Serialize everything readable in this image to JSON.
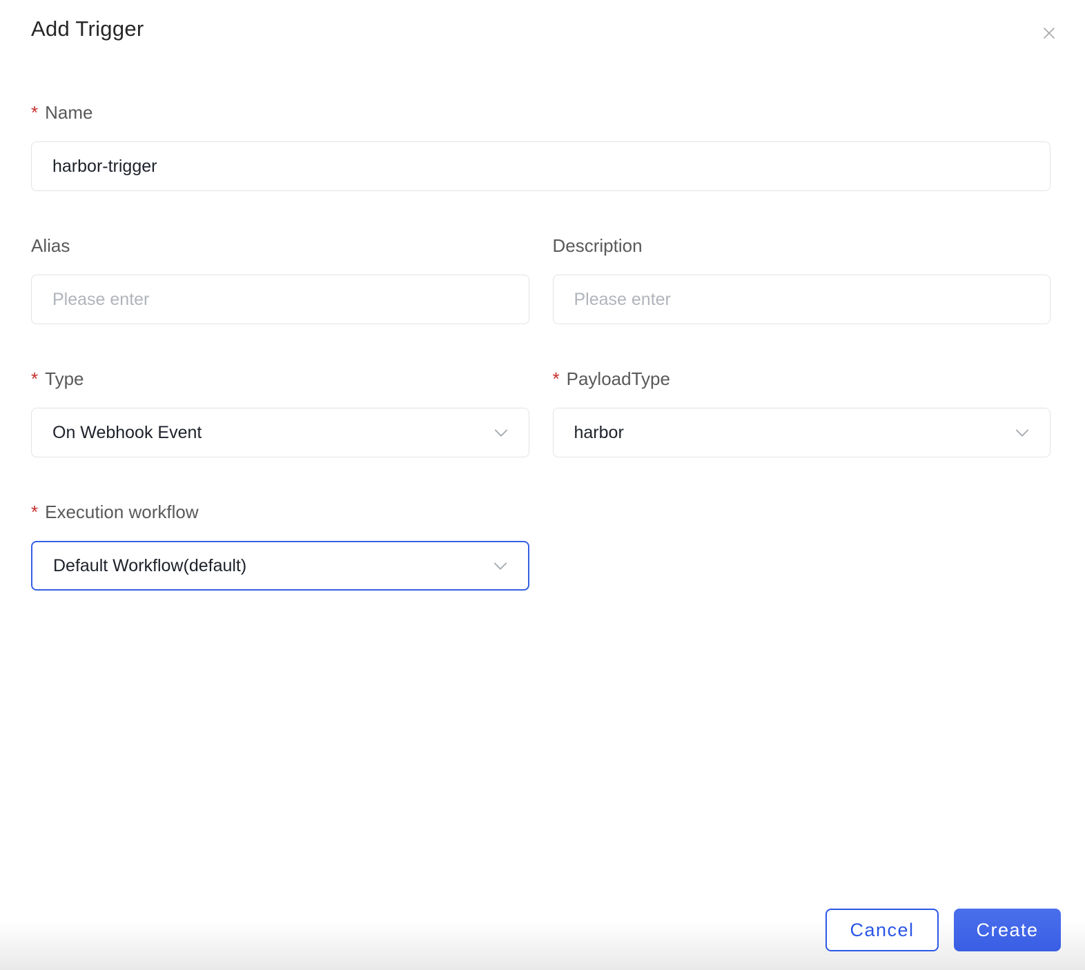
{
  "modal": {
    "title": "Add Trigger"
  },
  "form": {
    "required_marker": "*",
    "name": {
      "label": "Name",
      "required": true,
      "value": "harbor-trigger"
    },
    "alias": {
      "label": "Alias",
      "required": false,
      "value": "",
      "placeholder": "Please enter"
    },
    "description": {
      "label": "Description",
      "required": false,
      "value": "",
      "placeholder": "Please enter"
    },
    "type": {
      "label": "Type",
      "required": true,
      "selected": "On Webhook Event"
    },
    "payload_type": {
      "label": "PayloadType",
      "required": true,
      "selected": "harbor"
    },
    "execution_workflow": {
      "label": "Execution workflow",
      "required": true,
      "selected": "Default Workflow(default)",
      "focused": true
    }
  },
  "footer": {
    "cancel_label": "Cancel",
    "create_label": "Create"
  },
  "icons": {
    "close": "close-icon",
    "chevron_down": "chevron-down-icon"
  },
  "colors": {
    "accent_blue": "#3A5EE4",
    "focus_border_blue": "#3560E4",
    "required_red": "#C5302C",
    "label_gray": "#595959",
    "input_text": "#1D2129",
    "placeholder_gray": "#B0B4BB",
    "input_border": "#E2E3E6",
    "chevron_gray": "#A5A9B0",
    "close_gray": "#A6A6A6"
  }
}
